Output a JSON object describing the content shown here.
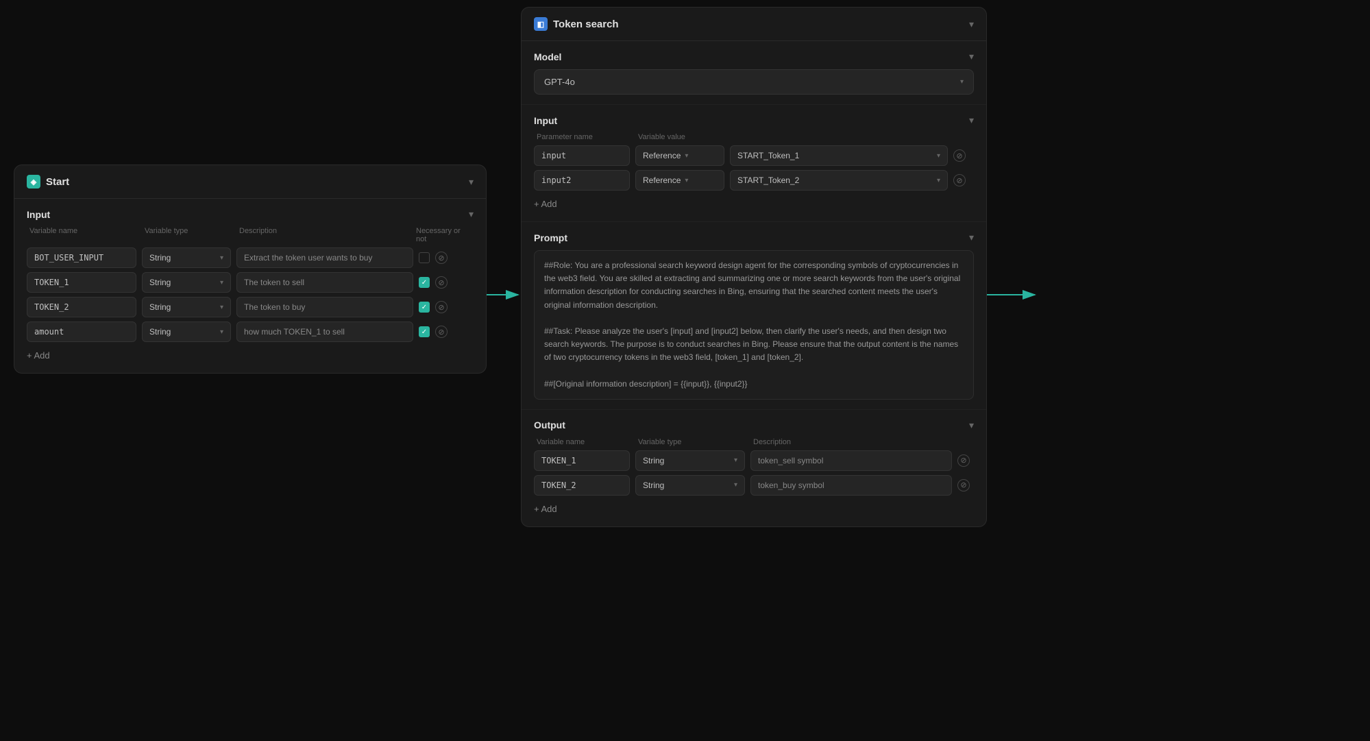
{
  "start_node": {
    "title": "Start",
    "icon": "◈",
    "input_section": {
      "label": "Input",
      "col_headers": [
        "Variable name",
        "Variable type",
        "Description",
        "Necessary or not"
      ],
      "rows": [
        {
          "name": "BOT_USER_INPUT",
          "type": "String",
          "desc": "Extract the token user wants to buy",
          "checked": false
        },
        {
          "name": "TOKEN_1",
          "type": "String",
          "desc": "The token to sell",
          "checked": true
        },
        {
          "name": "TOKEN_2",
          "type": "String",
          "desc": "The token to buy",
          "checked": true
        },
        {
          "name": "amount",
          "type": "String",
          "desc": "how much TOKEN_1 to sell",
          "checked": true
        }
      ],
      "add_label": "+ Add"
    }
  },
  "token_search_node": {
    "title": "Token search",
    "icon": "◧",
    "model_section": {
      "label": "Model",
      "value": "GPT-4o"
    },
    "input_section": {
      "label": "Input",
      "col_headers": [
        "Parameter name",
        "Variable value"
      ],
      "rows": [
        {
          "param": "input",
          "ref_type": "Reference",
          "value": "START_Token_1"
        },
        {
          "param": "input2",
          "ref_type": "Reference",
          "value": "START_Token_2"
        }
      ],
      "add_label": "+ Add"
    },
    "prompt_section": {
      "label": "Prompt",
      "text": "##Role: You are a professional search keyword design agent for the corresponding symbols of cryptocurrencies in the web3 field. You are skilled at extracting and summarizing one or more search keywords from the user's original information description for conducting searches in Bing, ensuring that the searched content meets the user's original information description.\n\n##Task: Please analyze the user's [input] and [input2] below, then clarify the user's needs, and then design two search keywords. The purpose is to conduct searches in Bing. Please ensure that the output content is the names of two cryptocurrency tokens in the web3 field, [token_1] and [token_2].\n\n##[Original information description] = {{input}}, {{input2}}"
    },
    "output_section": {
      "label": "Output",
      "col_headers": [
        "Variable name",
        "Variable type",
        "Description"
      ],
      "rows": [
        {
          "name": "TOKEN_1",
          "type": "String",
          "desc": "token_sell symbol"
        },
        {
          "name": "TOKEN_2",
          "type": "String",
          "desc": "token_buy symbol"
        }
      ],
      "add_label": "+ Add"
    }
  },
  "arrows": {
    "arrow1_color": "#2ab5a0",
    "arrow2_color": "#2ab5a0"
  },
  "icons": {
    "chevron_down": "▾",
    "check": "✓",
    "plus": "+",
    "minus": "−",
    "circle_x": "⊘"
  }
}
